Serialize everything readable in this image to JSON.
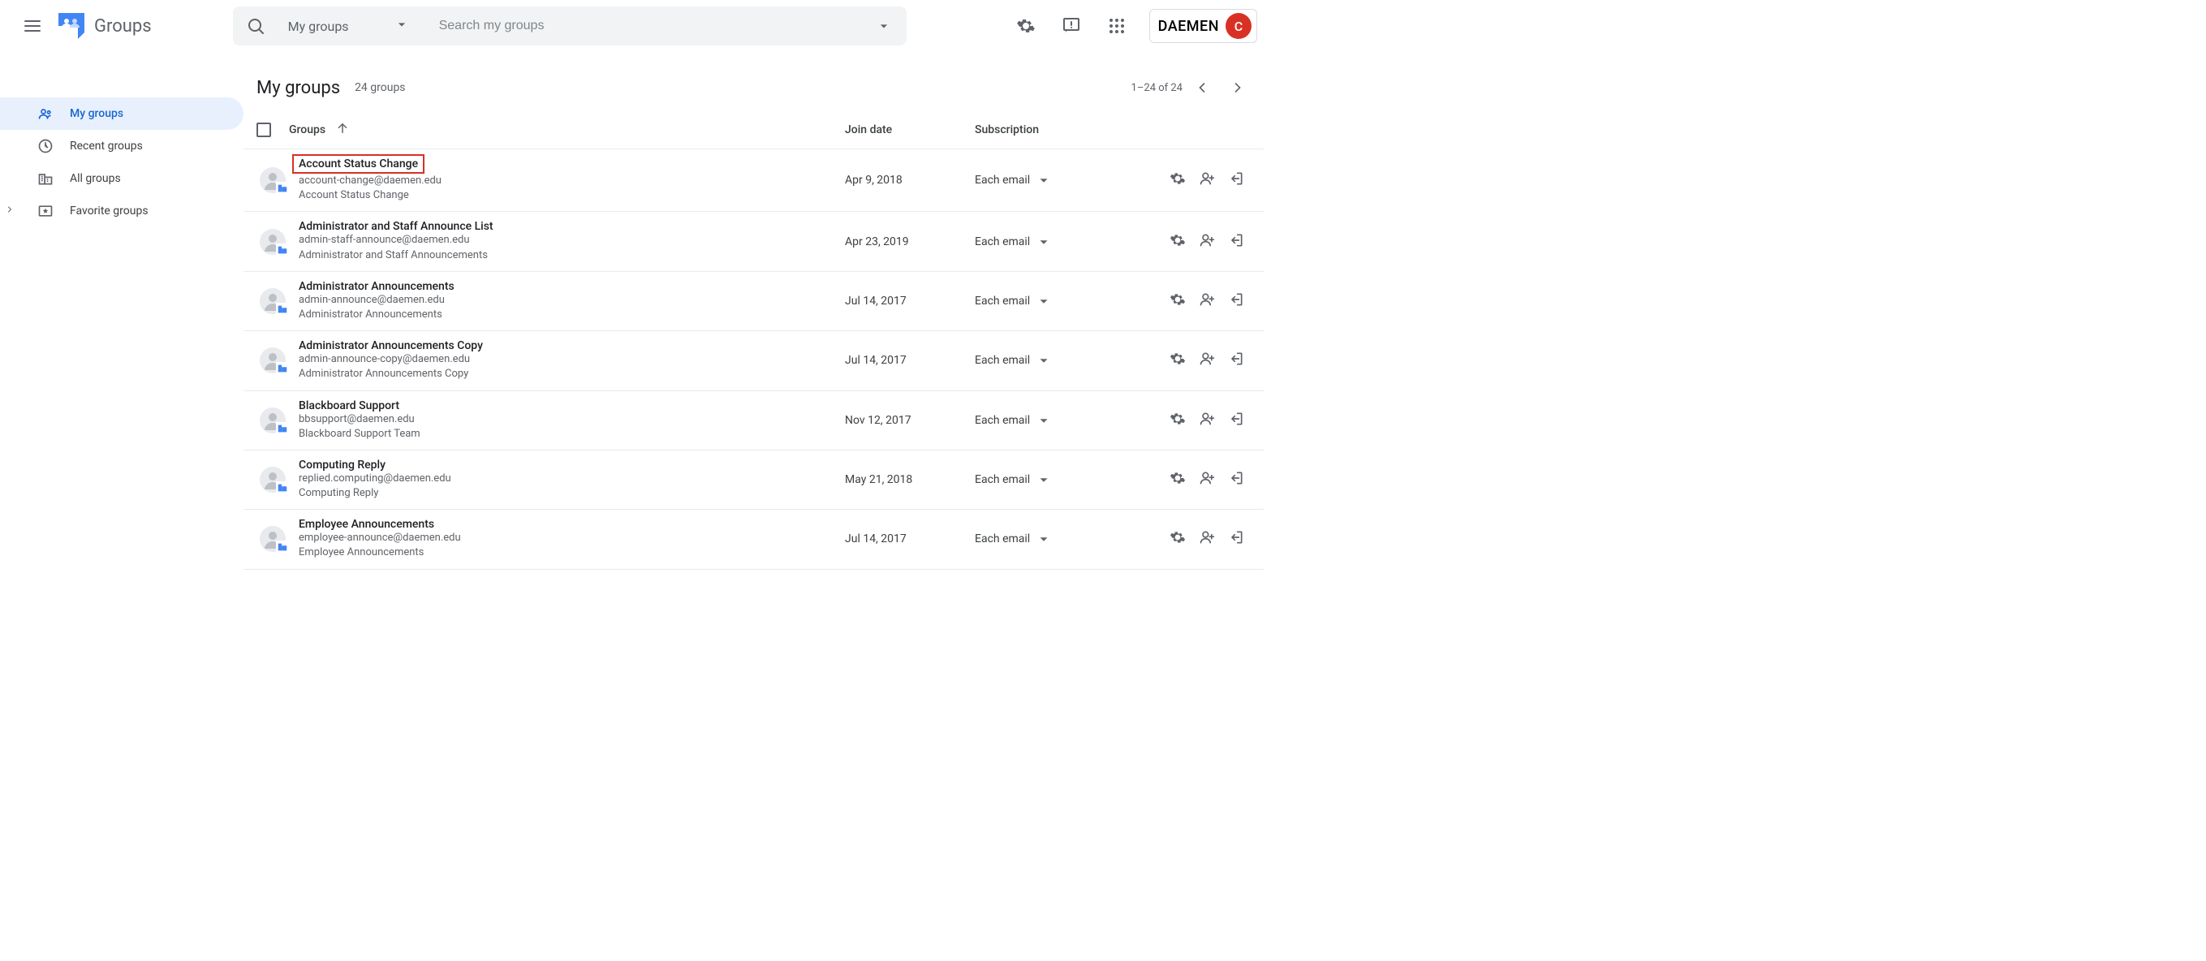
{
  "app": {
    "name": "Groups"
  },
  "header": {
    "search_scope": "My groups",
    "search_placeholder": "Search my groups",
    "brand": "DAEMEN",
    "avatar_letter": "C"
  },
  "sidebar": {
    "items": [
      {
        "label": "My groups",
        "icon": "groups"
      },
      {
        "label": "Recent groups",
        "icon": "recent"
      },
      {
        "label": "All groups",
        "icon": "domain"
      },
      {
        "label": "Favorite groups",
        "icon": "star"
      }
    ]
  },
  "page": {
    "title": "My groups",
    "count_label": "24 groups",
    "range_label": "1–24 of 24"
  },
  "columns": {
    "groups": "Groups",
    "join_date": "Join date",
    "subscription": "Subscription"
  },
  "rows": [
    {
      "name": "Account Status Change",
      "email": "account-change@daemen.edu",
      "desc": "Account Status Change",
      "date": "Apr 9, 2018",
      "sub": "Each email",
      "highlight": true
    },
    {
      "name": "Administrator and Staff Announce List",
      "email": "admin-staff-announce@daemen.edu",
      "desc": "Administrator and Staff Announcements",
      "date": "Apr 23, 2019",
      "sub": "Each email"
    },
    {
      "name": "Administrator Announcements",
      "email": "admin-announce@daemen.edu",
      "desc": "Administrator Announcements",
      "date": "Jul 14, 2017",
      "sub": "Each email"
    },
    {
      "name": "Administrator Announcements Copy",
      "email": "admin-announce-copy@daemen.edu",
      "desc": "Administrator Announcements Copy",
      "date": "Jul 14, 2017",
      "sub": "Each email"
    },
    {
      "name": "Blackboard Support",
      "email": "bbsupport@daemen.edu",
      "desc": "Blackboard Support Team",
      "date": "Nov 12, 2017",
      "sub": "Each email"
    },
    {
      "name": "Computing Reply",
      "email": "replied.computing@daemen.edu",
      "desc": "Computing Reply",
      "date": "May 21, 2018",
      "sub": "Each email"
    },
    {
      "name": "Employee Announcements",
      "email": "employee-announce@daemen.edu",
      "desc": "Employee Announcements",
      "date": "Jul 14, 2017",
      "sub": "Each email"
    }
  ]
}
